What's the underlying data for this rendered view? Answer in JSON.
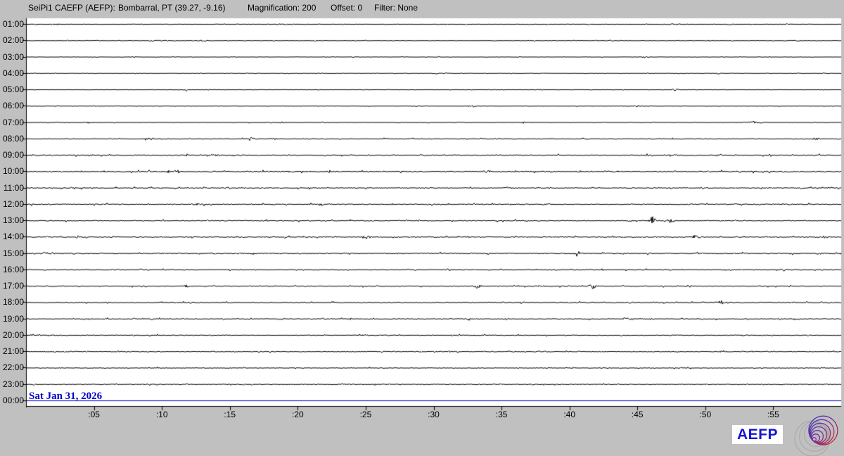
{
  "header": {
    "app_title": "SeiPi1 CAEFP (AEFP):",
    "station": "Bombarral, PT (39.27, -9.16)",
    "magnification_label": "Magnification: 200",
    "offset_label": "Offset: 0",
    "filter_label": "Filter: None"
  },
  "footer": {
    "date_label": "Sat Jan 31, 2026",
    "brand": "AEFP"
  },
  "colors": {
    "background": "#c0c0c0",
    "plot_bg": "#ffffff",
    "trace": "#000000",
    "accent_blue": "#0000cc",
    "logo_gray": "#aaaaaa",
    "logo_blue": "#3535bb",
    "logo_red": "#c03030"
  },
  "chart_data": {
    "type": "line",
    "title": "24-hour helicorder, one 60-minute trace per hour",
    "trace_color": "#000000",
    "minutes_per_row": 60,
    "x_ticks": [
      {
        "minute": 5,
        "label": ":05"
      },
      {
        "minute": 10,
        "label": ":10"
      },
      {
        "minute": 15,
        "label": ":15"
      },
      {
        "minute": 20,
        "label": ":20"
      },
      {
        "minute": 25,
        "label": ":25"
      },
      {
        "minute": 30,
        "label": ":30"
      },
      {
        "minute": 35,
        "label": ":35"
      },
      {
        "minute": 40,
        "label": ":40"
      },
      {
        "minute": 45,
        "label": ":45"
      },
      {
        "minute": 50,
        "label": ":50"
      },
      {
        "minute": 55,
        "label": ":55"
      }
    ],
    "rows": [
      {
        "label": "01:00",
        "noise": 0.22,
        "events": [
          {
            "m": 2.3,
            "amp": 1,
            "w": 2
          },
          {
            "m": 14.8,
            "amp": 1,
            "w": 3
          },
          {
            "m": 18.7,
            "amp": 1,
            "w": 4
          },
          {
            "m": 47.5,
            "amp": 1.2,
            "w": 6
          },
          {
            "m": 51.8,
            "amp": 1,
            "w": 5
          },
          {
            "m": 56,
            "amp": 1,
            "w": 4
          }
        ]
      },
      {
        "label": "02:00",
        "noise": 0.25,
        "events": [
          {
            "m": 9.5,
            "amp": 1.2,
            "w": 8
          },
          {
            "m": 13,
            "amp": 1,
            "w": 5
          },
          {
            "m": 16,
            "amp": 1,
            "w": 4
          },
          {
            "m": 43,
            "amp": 1,
            "w": 2
          },
          {
            "m": 50.3,
            "amp": 1,
            "w": 4
          },
          {
            "m": 56.5,
            "amp": 1,
            "w": 6
          }
        ]
      },
      {
        "label": "03:00",
        "noise": 0.18,
        "events": [
          {
            "m": 8,
            "amp": 1,
            "w": 4
          },
          {
            "m": 24.5,
            "amp": 1,
            "w": 5
          },
          {
            "m": 45.6,
            "amp": 1.2,
            "w": 4
          }
        ]
      },
      {
        "label": "04:00",
        "noise": 0.18,
        "events": [
          {
            "m": 12.8,
            "amp": 1,
            "w": 4
          },
          {
            "m": 30.5,
            "amp": 1,
            "w": 8
          },
          {
            "m": 38,
            "amp": 1.2,
            "w": 3
          },
          {
            "m": 51,
            "amp": 1,
            "w": 4
          },
          {
            "m": 58.8,
            "amp": 1,
            "w": 3
          }
        ]
      },
      {
        "label": "05:00",
        "noise": 0.18,
        "events": [
          {
            "m": 11.8,
            "amp": 2.2,
            "w": 2
          },
          {
            "m": 13.5,
            "amp": 1,
            "w": 6
          },
          {
            "m": 47.8,
            "amp": 2.2,
            "w": 3
          }
        ]
      },
      {
        "label": "06:00",
        "noise": 0.2,
        "events": [
          {
            "m": 2.5,
            "amp": 1,
            "w": 3
          },
          {
            "m": 32.8,
            "amp": 2.2,
            "w": 3
          },
          {
            "m": 45,
            "amp": 1,
            "w": 4
          }
        ]
      },
      {
        "label": "07:00",
        "noise": 0.25,
        "events": [
          {
            "m": 4.6,
            "amp": 1.5,
            "w": 3
          },
          {
            "m": 18.7,
            "amp": 1.2,
            "w": 4
          },
          {
            "m": 36.6,
            "amp": 1.5,
            "w": 2
          },
          {
            "m": 53.6,
            "amp": 2,
            "w": 8
          },
          {
            "m": 58,
            "amp": 1,
            "w": 4
          }
        ]
      },
      {
        "label": "08:00",
        "noise": 0.35,
        "events": [
          {
            "m": 9.1,
            "amp": 2,
            "w": 4
          },
          {
            "m": 16.5,
            "amp": 2.5,
            "w": 5
          },
          {
            "m": 18.3,
            "amp": 1.8,
            "w": 3
          },
          {
            "m": 58.2,
            "amp": 2,
            "w": 4
          }
        ]
      },
      {
        "label": "09:00",
        "noise": 0.45,
        "events": [
          {
            "m": 0.6,
            "amp": 2.5,
            "w": 3
          },
          {
            "m": 2,
            "amp": 1.8,
            "w": 2
          },
          {
            "m": 4.6,
            "amp": 1.8,
            "w": 3
          },
          {
            "m": 13.8,
            "amp": 2.5,
            "w": 5
          }
        ]
      },
      {
        "label": "10:00",
        "noise": 0.5,
        "events": [
          {
            "m": 10.5,
            "amp": 1.5,
            "w": 3
          },
          {
            "m": 19.5,
            "amp": 1.3,
            "w": 3
          },
          {
            "m": 33.9,
            "amp": 2,
            "w": 3
          }
        ]
      },
      {
        "label": "11:00",
        "noise": 0.45,
        "events": [
          {
            "m": 37.8,
            "amp": 1.3,
            "w": 3
          },
          {
            "m": 49.8,
            "amp": 1.5,
            "w": 3
          },
          {
            "m": 57,
            "amp": 1.3,
            "w": 3
          }
        ]
      },
      {
        "label": "12:00",
        "noise": 0.45,
        "events": [
          {
            "m": 12.6,
            "amp": 2.2,
            "w": 5
          },
          {
            "m": 21.7,
            "amp": 3.5,
            "w": 2
          },
          {
            "m": 38.5,
            "amp": 1.8,
            "w": 3
          },
          {
            "m": 54,
            "amp": 1.3,
            "w": 3
          }
        ]
      },
      {
        "label": "13:00",
        "noise": 0.45,
        "events": [
          {
            "m": 46.1,
            "amp": 7,
            "w": 3
          },
          {
            "m": 47.4,
            "amp": 3,
            "w": 5
          },
          {
            "m": 52.2,
            "amp": 2.5,
            "w": 1.5
          }
        ]
      },
      {
        "label": "14:00",
        "noise": 0.45,
        "events": [
          {
            "m": 25,
            "amp": 3.5,
            "w": 4
          },
          {
            "m": 32.5,
            "amp": 1.5,
            "w": 5
          },
          {
            "m": 49.3,
            "amp": 3,
            "w": 5
          },
          {
            "m": 58.7,
            "amp": 2.2,
            "w": 5
          }
        ]
      },
      {
        "label": "15:00",
        "noise": 0.45,
        "events": [
          {
            "m": 1.3,
            "amp": 2.2,
            "w": 3
          },
          {
            "m": 1.9,
            "amp": 2.5,
            "w": 2
          },
          {
            "m": 3.5,
            "amp": 1.8,
            "w": 2
          },
          {
            "m": 10,
            "amp": 1.3,
            "w": 4
          },
          {
            "m": 40.6,
            "amp": 5,
            "w": 3
          },
          {
            "m": 49.4,
            "amp": 2,
            "w": 2
          },
          {
            "m": 58.5,
            "amp": 1.3,
            "w": 5
          }
        ]
      },
      {
        "label": "16:00",
        "noise": 0.4,
        "events": [
          {
            "m": 8.4,
            "amp": 1.5,
            "w": 3
          },
          {
            "m": 31.1,
            "amp": 2,
            "w": 3
          },
          {
            "m": 55.6,
            "amp": 2,
            "w": 3
          }
        ]
      },
      {
        "label": "17:00",
        "noise": 0.4,
        "events": [
          {
            "m": 11.8,
            "amp": 2,
            "w": 3
          },
          {
            "m": 33.2,
            "amp": 4.5,
            "w": 3
          },
          {
            "m": 37.9,
            "amp": 2,
            "w": 3
          },
          {
            "m": 41.7,
            "amp": 4.5,
            "w": 3
          }
        ]
      },
      {
        "label": "18:00",
        "noise": 0.4,
        "events": [
          {
            "m": 36.5,
            "amp": 1.3,
            "w": 3
          },
          {
            "m": 44.5,
            "amp": 1.5,
            "w": 2
          },
          {
            "m": 51.2,
            "amp": 2.8,
            "w": 6
          }
        ]
      },
      {
        "label": "19:00",
        "noise": 0.4,
        "events": [
          {
            "m": 32.5,
            "amp": 1.2,
            "w": 3
          },
          {
            "m": 39.5,
            "amp": 1.3,
            "w": 3
          },
          {
            "m": 44.2,
            "amp": 2.2,
            "w": 4
          }
        ]
      },
      {
        "label": "20:00",
        "noise": 0.38,
        "events": [
          {
            "m": 25,
            "amp": 1,
            "w": 3
          }
        ]
      },
      {
        "label": "21:00",
        "noise": 0.35,
        "events": [
          {
            "m": 51.1,
            "amp": 1.4,
            "w": 3
          },
          {
            "m": 54.5,
            "amp": 1.2,
            "w": 2
          }
        ]
      },
      {
        "label": "22:00",
        "noise": 0.33,
        "events": []
      },
      {
        "label": "23:00",
        "noise": 0.33,
        "events": []
      },
      {
        "label": "00:00",
        "noise": 0,
        "color": "#0000cc",
        "events": []
      }
    ]
  }
}
